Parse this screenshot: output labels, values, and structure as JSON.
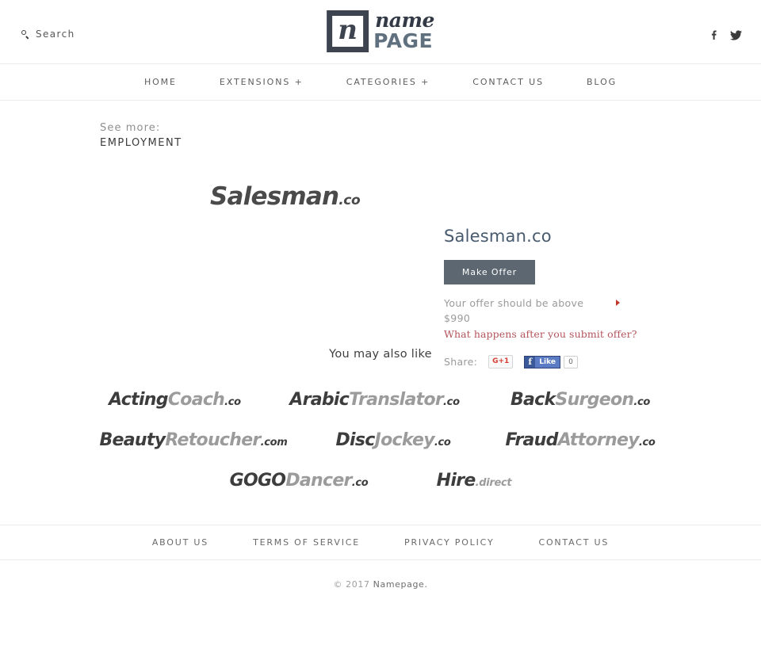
{
  "header": {
    "search_label": "Search",
    "search_icon": "search-icon",
    "brand": {
      "mark_glyph": "n",
      "name": "name",
      "page": "PAGE"
    },
    "social": [
      {
        "name": "facebook-icon",
        "title": "Facebook"
      },
      {
        "name": "twitter-icon",
        "title": "Twitter"
      }
    ]
  },
  "nav": {
    "items": [
      {
        "label": "HOME"
      },
      {
        "label": "EXTENSIONS +"
      },
      {
        "label": "CATEGORIES +"
      },
      {
        "label": "CONTACT US"
      },
      {
        "label": "BLOG"
      }
    ]
  },
  "seemore": {
    "label": "See more:",
    "category": "EMPLOYMENT"
  },
  "product": {
    "logo_main": "Salesman",
    "logo_tld": ".co",
    "title": "Salesman.co",
    "make_offer_label": "Make Offer",
    "offer_note": "Your offer should be above $990",
    "offer_min": "$990",
    "offer_link": "What happens after you submit offer?",
    "share_label": "Share:",
    "gplus_label": "G+1",
    "fb_f": "f",
    "fb_like_label": "Like",
    "fb_count": "0",
    "accent_red": "#b4545c",
    "button_color": "#5c6771",
    "title_color": "#485a6e"
  },
  "also_like": {
    "title": "You may also like",
    "items": [
      {
        "p1": "Acting",
        "p2": "Coach",
        "tld": ".co",
        "tld_light": false
      },
      {
        "p1": "Arabic",
        "p2": "Translator",
        "tld": ".co",
        "tld_light": false
      },
      {
        "p1": "Back",
        "p2": "Surgeon",
        "tld": ".co",
        "tld_light": false
      },
      {
        "p1": "Beauty",
        "p2": "Retoucher",
        "tld": ".com",
        "tld_light": false
      },
      {
        "p1": "Disc",
        "p2": "Jockey",
        "tld": ".co",
        "tld_light": false
      },
      {
        "p1": "Fraud",
        "p2": "Attorney",
        "tld": ".co",
        "tld_light": false
      },
      {
        "p1": "GOGO",
        "p2": "Dancer",
        "tld": ".co",
        "tld_light": false
      },
      {
        "p1": "Hire",
        "p2": "",
        "tld": ".direct",
        "tld_light": true
      }
    ]
  },
  "footer": {
    "links": [
      {
        "label": "ABOUT US"
      },
      {
        "label": "TERMS OF SERVICE"
      },
      {
        "label": "PRIVACY POLICY"
      },
      {
        "label": "CONTACT US"
      }
    ],
    "copyright_prefix": "© 2017 ",
    "copyright_name": "Namepage."
  }
}
